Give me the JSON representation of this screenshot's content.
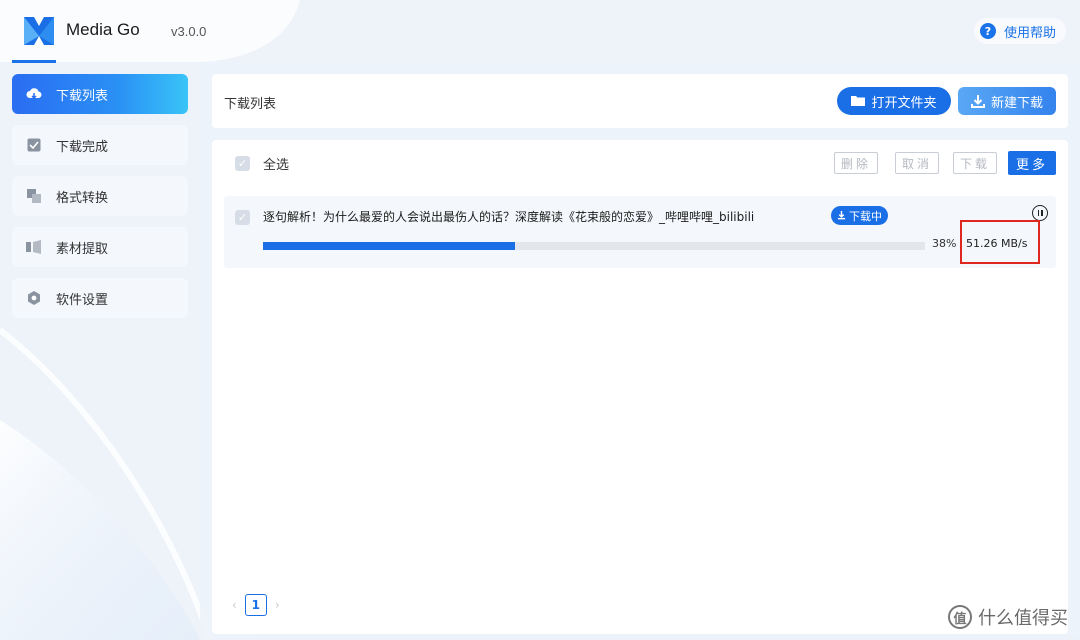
{
  "app": {
    "name": "Media Go",
    "version": "v3.0.0",
    "help_label": "使用帮助",
    "help_icon": "question-circle-icon"
  },
  "sidebar": {
    "items": [
      {
        "label": "下载列表",
        "icon": "cloud-download-icon",
        "active": true
      },
      {
        "label": "下载完成",
        "icon": "check-square-icon",
        "active": false
      },
      {
        "label": "格式转换",
        "icon": "convert-icon",
        "active": false
      },
      {
        "label": "素材提取",
        "icon": "extract-icon",
        "active": false
      },
      {
        "label": "软件设置",
        "icon": "gear-icon",
        "active": false
      }
    ]
  },
  "header": {
    "title": "下载列表",
    "open_folder_label": "打开文件夹",
    "new_download_label": "新建下载"
  },
  "toolbar": {
    "select_all_label": "全选",
    "delete_label": "删除",
    "cancel_label": "取消",
    "download_label": "下载",
    "more_label": "更多"
  },
  "downloads": [
    {
      "title": "逐句解析！为什么最爱的人会说出最伤人的话？深度解读《花束般的恋爱》_哔哩哔哩_bilibili",
      "status": "下载中",
      "progress": 0.38,
      "percent_text": "38%",
      "speed": "51.26 MB/s"
    }
  ],
  "pagination": {
    "current_page": "1",
    "prev": "‹",
    "next": "›"
  },
  "watermark": {
    "text": "什么值得买",
    "icon": "值"
  },
  "colors": {
    "accent": "#1a6fe6",
    "highlight": "#e0271f"
  }
}
